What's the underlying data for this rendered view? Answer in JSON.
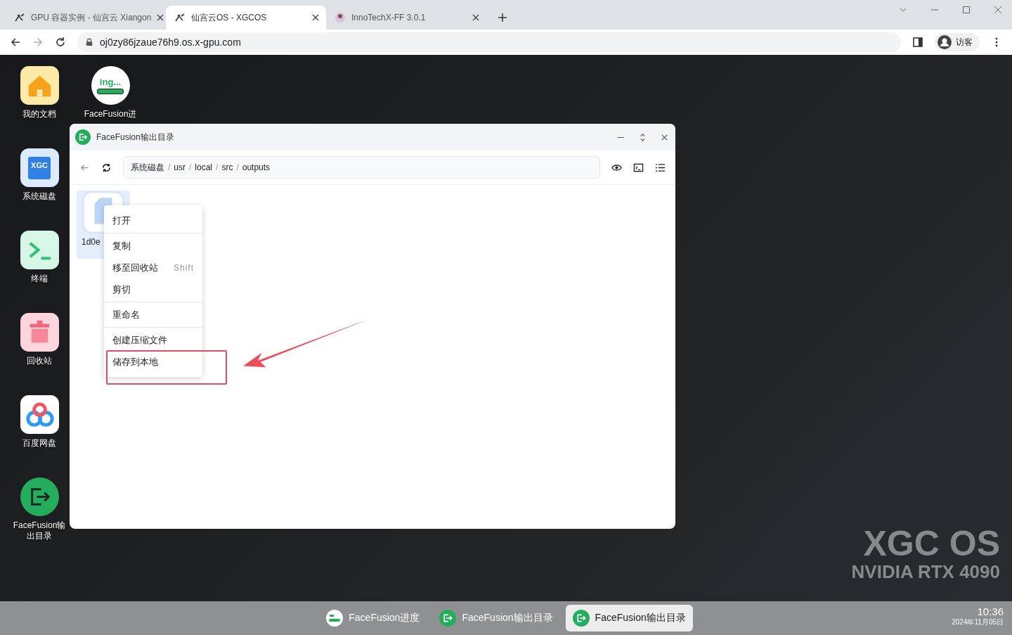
{
  "browser": {
    "tabs": [
      {
        "title": "GPU 容器实例 - 仙宫云 Xiangon",
        "kind": "xgc",
        "selected": false
      },
      {
        "title": "仙宫云OS - XGCOS",
        "kind": "xgc",
        "selected": true
      },
      {
        "title": "InnoTechX-FF 3.0.1",
        "kind": "avatar",
        "selected": false
      }
    ],
    "url": "oj0zy86jzaue76h9.os.x-gpu.com",
    "profile": "访客"
  },
  "desktop": {
    "icons": [
      {
        "kind": "docs",
        "label": "我的文档"
      },
      {
        "kind": "disk",
        "label": "系统磁盘",
        "badge": "XGC"
      },
      {
        "kind": "terminal",
        "label": "终端"
      },
      {
        "kind": "trash",
        "label": "回收站"
      },
      {
        "kind": "cloud",
        "label": "百度网盘"
      },
      {
        "kind": "folder-out",
        "label": "FaceFusion输出目录"
      }
    ],
    "progress_icon": {
      "label": "FaceFusion进",
      "badge": "ing..."
    },
    "wallpaper": {
      "title": "XGC OS",
      "subtitle": "NVIDIA RTX 4090"
    }
  },
  "window": {
    "title": "FaceFusion输出目录",
    "path": [
      "系统磁盘",
      "usr",
      "local",
      "src",
      "outputs"
    ],
    "path_separator": "/",
    "files": [
      {
        "name": "1d0e",
        "selected": true
      }
    ]
  },
  "context_menu": {
    "groups": [
      {
        "items": [
          {
            "label": "打开",
            "highlighted": false
          }
        ]
      },
      {
        "items": [
          {
            "label": "复制",
            "highlighted": false
          },
          {
            "label": "移至回收站",
            "shortcut": "Shift",
            "highlighted": false
          },
          {
            "label": "剪切",
            "highlighted": false
          }
        ]
      },
      {
        "items": [
          {
            "label": "重命名",
            "highlighted": false
          }
        ]
      },
      {
        "items": [
          {
            "label": "创建压缩文件",
            "highlighted": false
          },
          {
            "label": "储存到本地",
            "highlighted": true
          }
        ]
      }
    ]
  },
  "taskbar": {
    "items": [
      {
        "kind": "progress",
        "label": "FaceFusion进度",
        "selected": false
      },
      {
        "kind": "folder-out",
        "label": "FaceFusion输出目录",
        "selected": false
      },
      {
        "kind": "folder-out",
        "label": "FaceFusion输出目录",
        "selected": true
      }
    ],
    "clock": {
      "time": "10:36",
      "date": "2024年11月05日"
    }
  }
}
